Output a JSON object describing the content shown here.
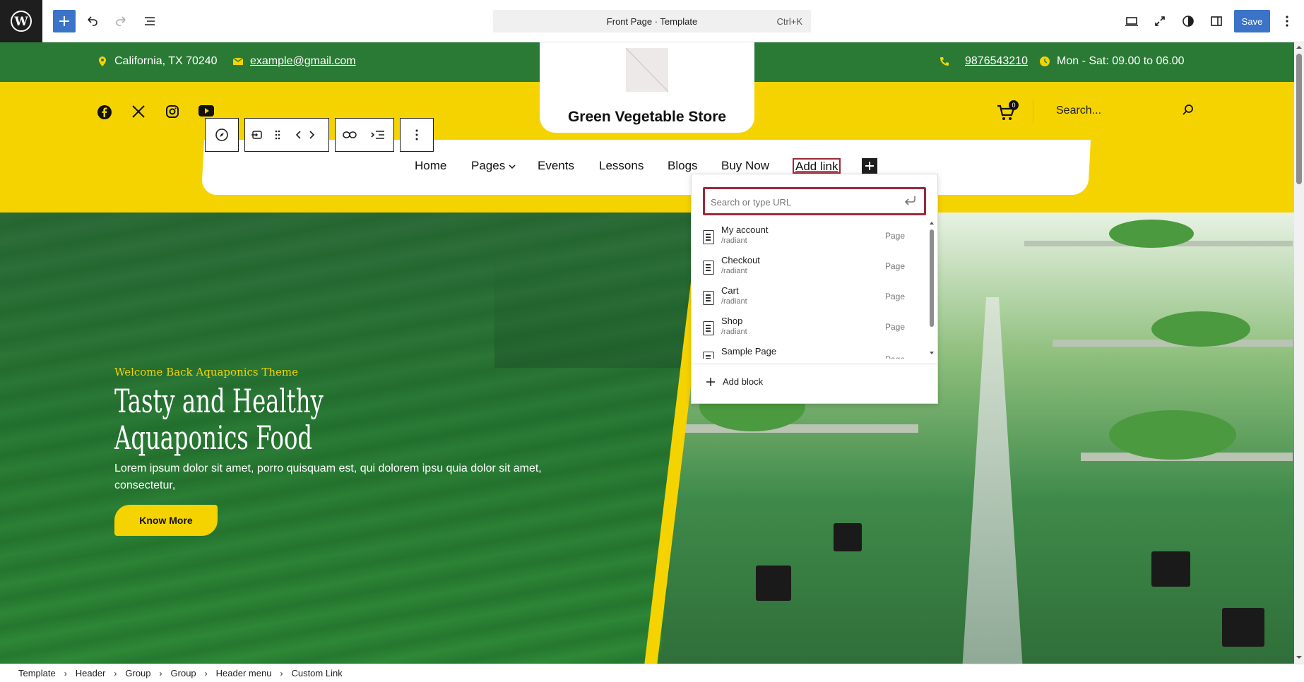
{
  "editor": {
    "command_title": "Front Page · Template",
    "command_shortcut": "Ctrl+K",
    "save_label": "Save"
  },
  "topstrip": {
    "address": "California, TX 70240",
    "email": "example@gmail.com",
    "phone": "9876543210",
    "hours": "Mon - Sat: 09.00 to 06.00"
  },
  "site": {
    "title": "Green Vegetable Store",
    "cart_count": "0",
    "search_placeholder": "Search..."
  },
  "nav": {
    "items": [
      "Home",
      "Pages",
      "Events",
      "Lessons",
      "Blogs",
      "Buy Now"
    ],
    "add_link": "Add link"
  },
  "hero": {
    "subtitle": "Welcome Back Aquaponics Theme",
    "title_line1": "Tasty and Healthy",
    "title_line2": "Aquaponics Food",
    "text": "Lorem ipsum dolor sit amet, porro quisquam est, qui dolorem ipsu quia dolor sit amet, consectetur,",
    "button": "Know More"
  },
  "link_popover": {
    "placeholder": "Search or type URL",
    "suggestions": [
      {
        "title": "My account",
        "url": "/radiant",
        "kind": "Page"
      },
      {
        "title": "Checkout",
        "url": "/radiant",
        "kind": "Page"
      },
      {
        "title": "Cart",
        "url": "/radiant",
        "kind": "Page"
      },
      {
        "title": "Shop",
        "url": "/radiant",
        "kind": "Page"
      },
      {
        "title": "Sample Page",
        "url": "",
        "kind": "Page"
      }
    ],
    "add_block": "Add block"
  },
  "breadcrumb": [
    "Template",
    "Header",
    "Group",
    "Group",
    "Header menu",
    "Custom Link"
  ],
  "colors": {
    "green": "#2a7a35",
    "yellow": "#f5d300",
    "accent_blue": "#3a73c8",
    "focus_red": "#9b2a37"
  }
}
